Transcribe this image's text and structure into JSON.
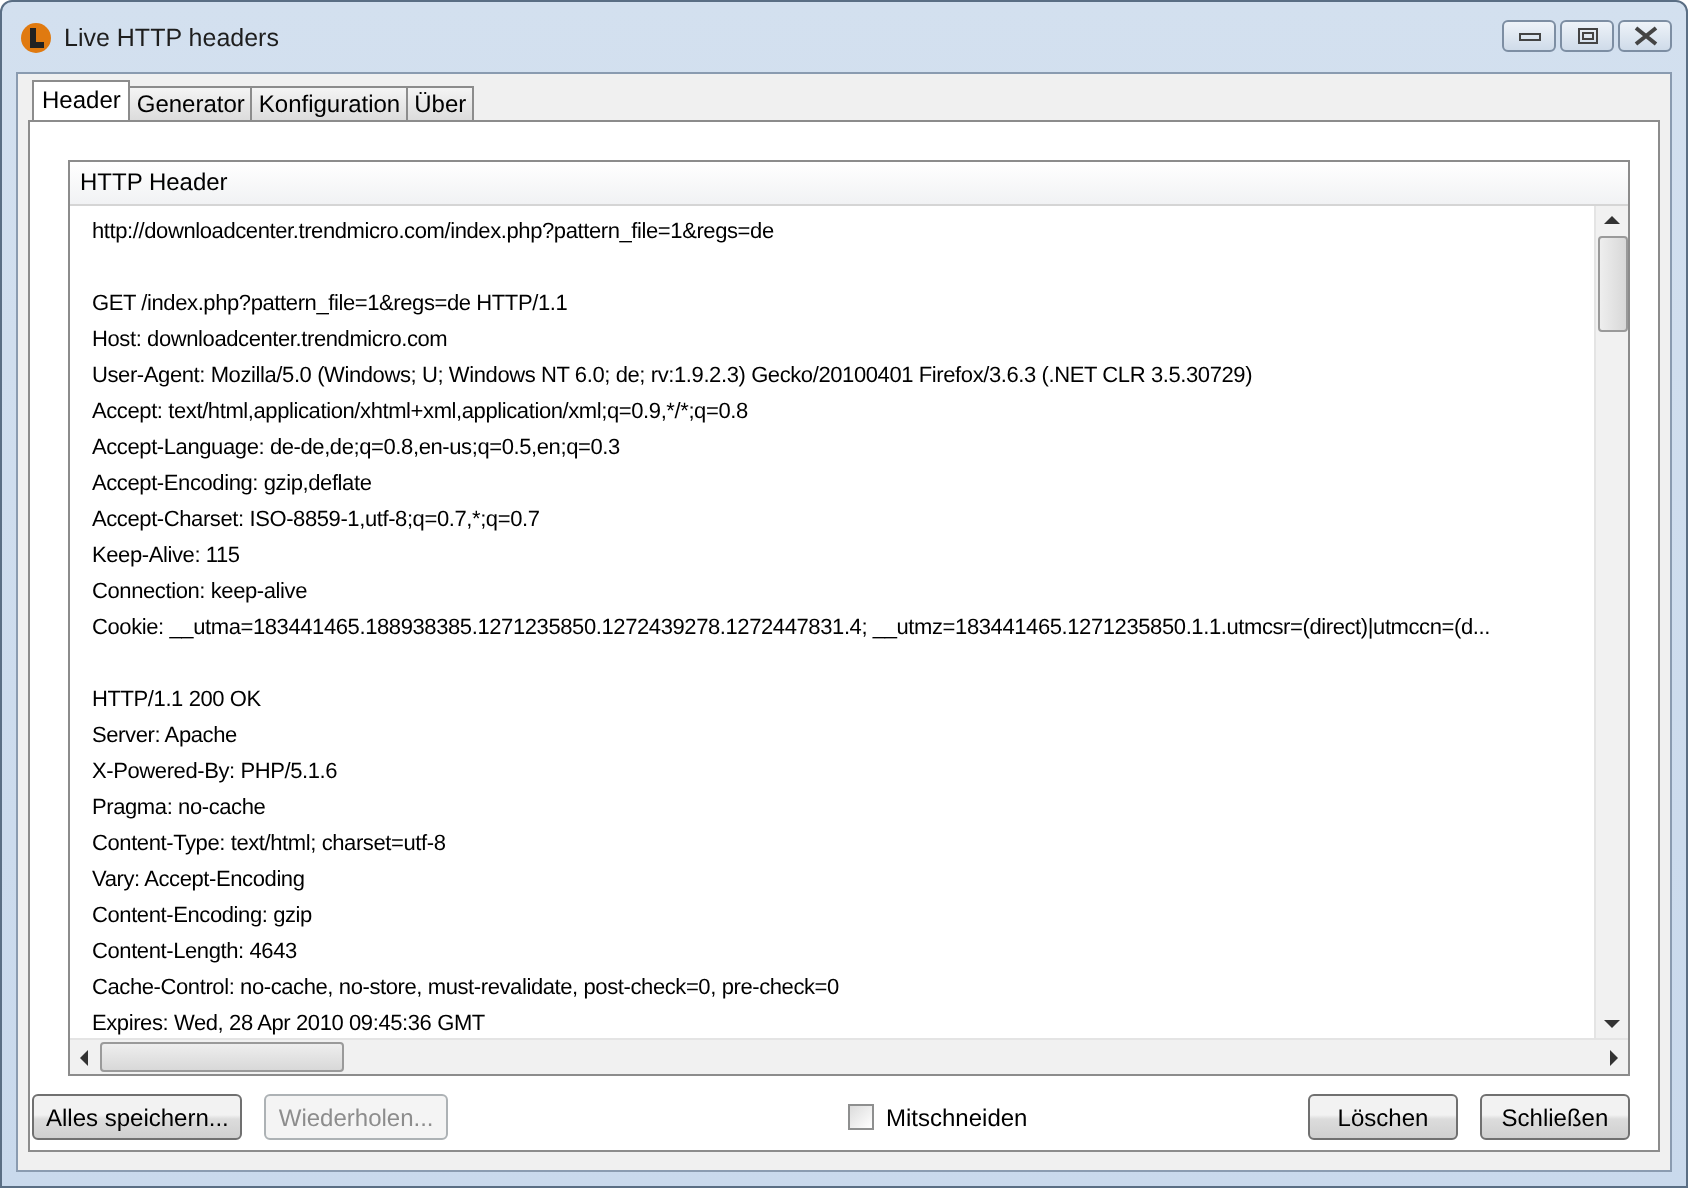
{
  "window": {
    "title": "Live HTTP headers"
  },
  "tabs": [
    {
      "label": "Header",
      "selected": true
    },
    {
      "label": "Generator",
      "selected": false
    },
    {
      "label": "Konfiguration",
      "selected": false
    },
    {
      "label": "Über",
      "selected": false
    }
  ],
  "list": {
    "heading": "HTTP Header",
    "blocks": [
      [
        "http://downloadcenter.trendmicro.com/index.php?pattern_file=1&regs=de"
      ],
      [
        "GET /index.php?pattern_file=1&regs=de HTTP/1.1",
        "Host: downloadcenter.trendmicro.com",
        "User-Agent: Mozilla/5.0 (Windows; U; Windows NT 6.0; de; rv:1.9.2.3) Gecko/20100401 Firefox/3.6.3 (.NET CLR 3.5.30729)",
        "Accept: text/html,application/xhtml+xml,application/xml;q=0.9,*/*;q=0.8",
        "Accept-Language: de-de,de;q=0.8,en-us;q=0.5,en;q=0.3",
        "Accept-Encoding: gzip,deflate",
        "Accept-Charset: ISO-8859-1,utf-8;q=0.7,*;q=0.7",
        "Keep-Alive: 115",
        "Connection: keep-alive",
        "Cookie: __utma=183441465.188938385.1271235850.1272439278.1272447831.4; __utmz=183441465.1271235850.1.1.utmcsr=(direct)|utmccn=(d..."
      ],
      [
        "HTTP/1.1 200 OK",
        "Server: Apache",
        "X-Powered-By: PHP/5.1.6",
        "Pragma: no-cache",
        "Content-Type: text/html; charset=utf-8",
        "Vary: Accept-Encoding",
        "Content-Encoding: gzip",
        "Content-Length: 4643",
        "Cache-Control: no-cache, no-store, must-revalidate, post-check=0, pre-check=0",
        "Expires: Wed, 28 Apr 2010 09:45:36 GMT"
      ]
    ]
  },
  "buttons_left": [
    {
      "label": "Alles speichern...",
      "disabled": false
    },
    {
      "label": "Wiederholen...",
      "disabled": true
    }
  ],
  "capture": {
    "label": "Mitschneiden",
    "checked": false
  },
  "buttons_right": [
    {
      "label": "Löschen",
      "disabled": false
    },
    {
      "label": "Schließen",
      "disabled": false
    }
  ]
}
